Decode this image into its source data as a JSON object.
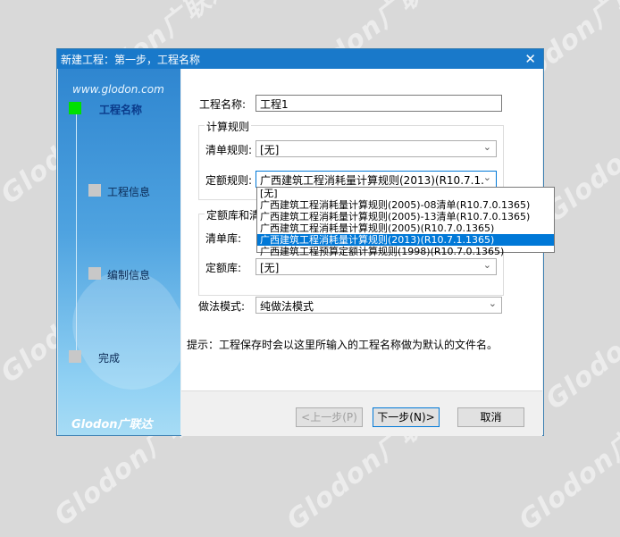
{
  "watermark": "Glodon广联达",
  "dialog": {
    "title": "新建工程：第一步，工程名称",
    "close_glyph": "✕"
  },
  "sidebar": {
    "url": "www.glodon.com",
    "steps": [
      {
        "label": "工程名称",
        "active": true
      },
      {
        "label": "工程信息",
        "active": false
      },
      {
        "label": "编制信息",
        "active": false
      },
      {
        "label": "完成",
        "active": false
      }
    ],
    "logo": "Glodon广联达"
  },
  "form": {
    "project_name_label": "工程名称:",
    "project_name_value": "工程1",
    "calc_rules_group": "计算规则",
    "bill_rule_label": "清单规则:",
    "bill_rule_value": "[无]",
    "quota_rule_label": "定额规则:",
    "quota_rule_value": "广西建筑工程消耗量计算规则(2013)(R10.7.1.",
    "quota_lib_group": "定额库和清",
    "bill_lib_label": "清单库:",
    "quota_lib_label": "定额库:",
    "quota_lib_value": "[无]",
    "method_label": "做法模式:",
    "method_value": "纯做法模式",
    "hint": "提示：工程保存时会以这里所输入的工程名称做为默认的文件名。"
  },
  "dropdown": {
    "options": [
      "[无]",
      "广西建筑工程消耗量计算规则(2005)-08清单(R10.7.0.1365)",
      "广西建筑工程消耗量计算规则(2005)-13清单(R10.7.0.1365)",
      "广西建筑工程消耗量计算规则(2005)(R10.7.0.1365)",
      "广西建筑工程消耗量计算规则(2013)(R10.7.1.1365)",
      "广西建筑工程预算定额计算规则(1998)(R10.7.0.1365)"
    ],
    "selected": "广西建筑工程消耗量计算规则(2013)(R10.7.1.1365)"
  },
  "buttons": {
    "prev": "<上一步(P)",
    "next": "下一步(N)>",
    "cancel": "取消"
  },
  "colors": {
    "titlebar": "#1979ca",
    "active_step": "#00e000",
    "selection": "#0078d7"
  }
}
